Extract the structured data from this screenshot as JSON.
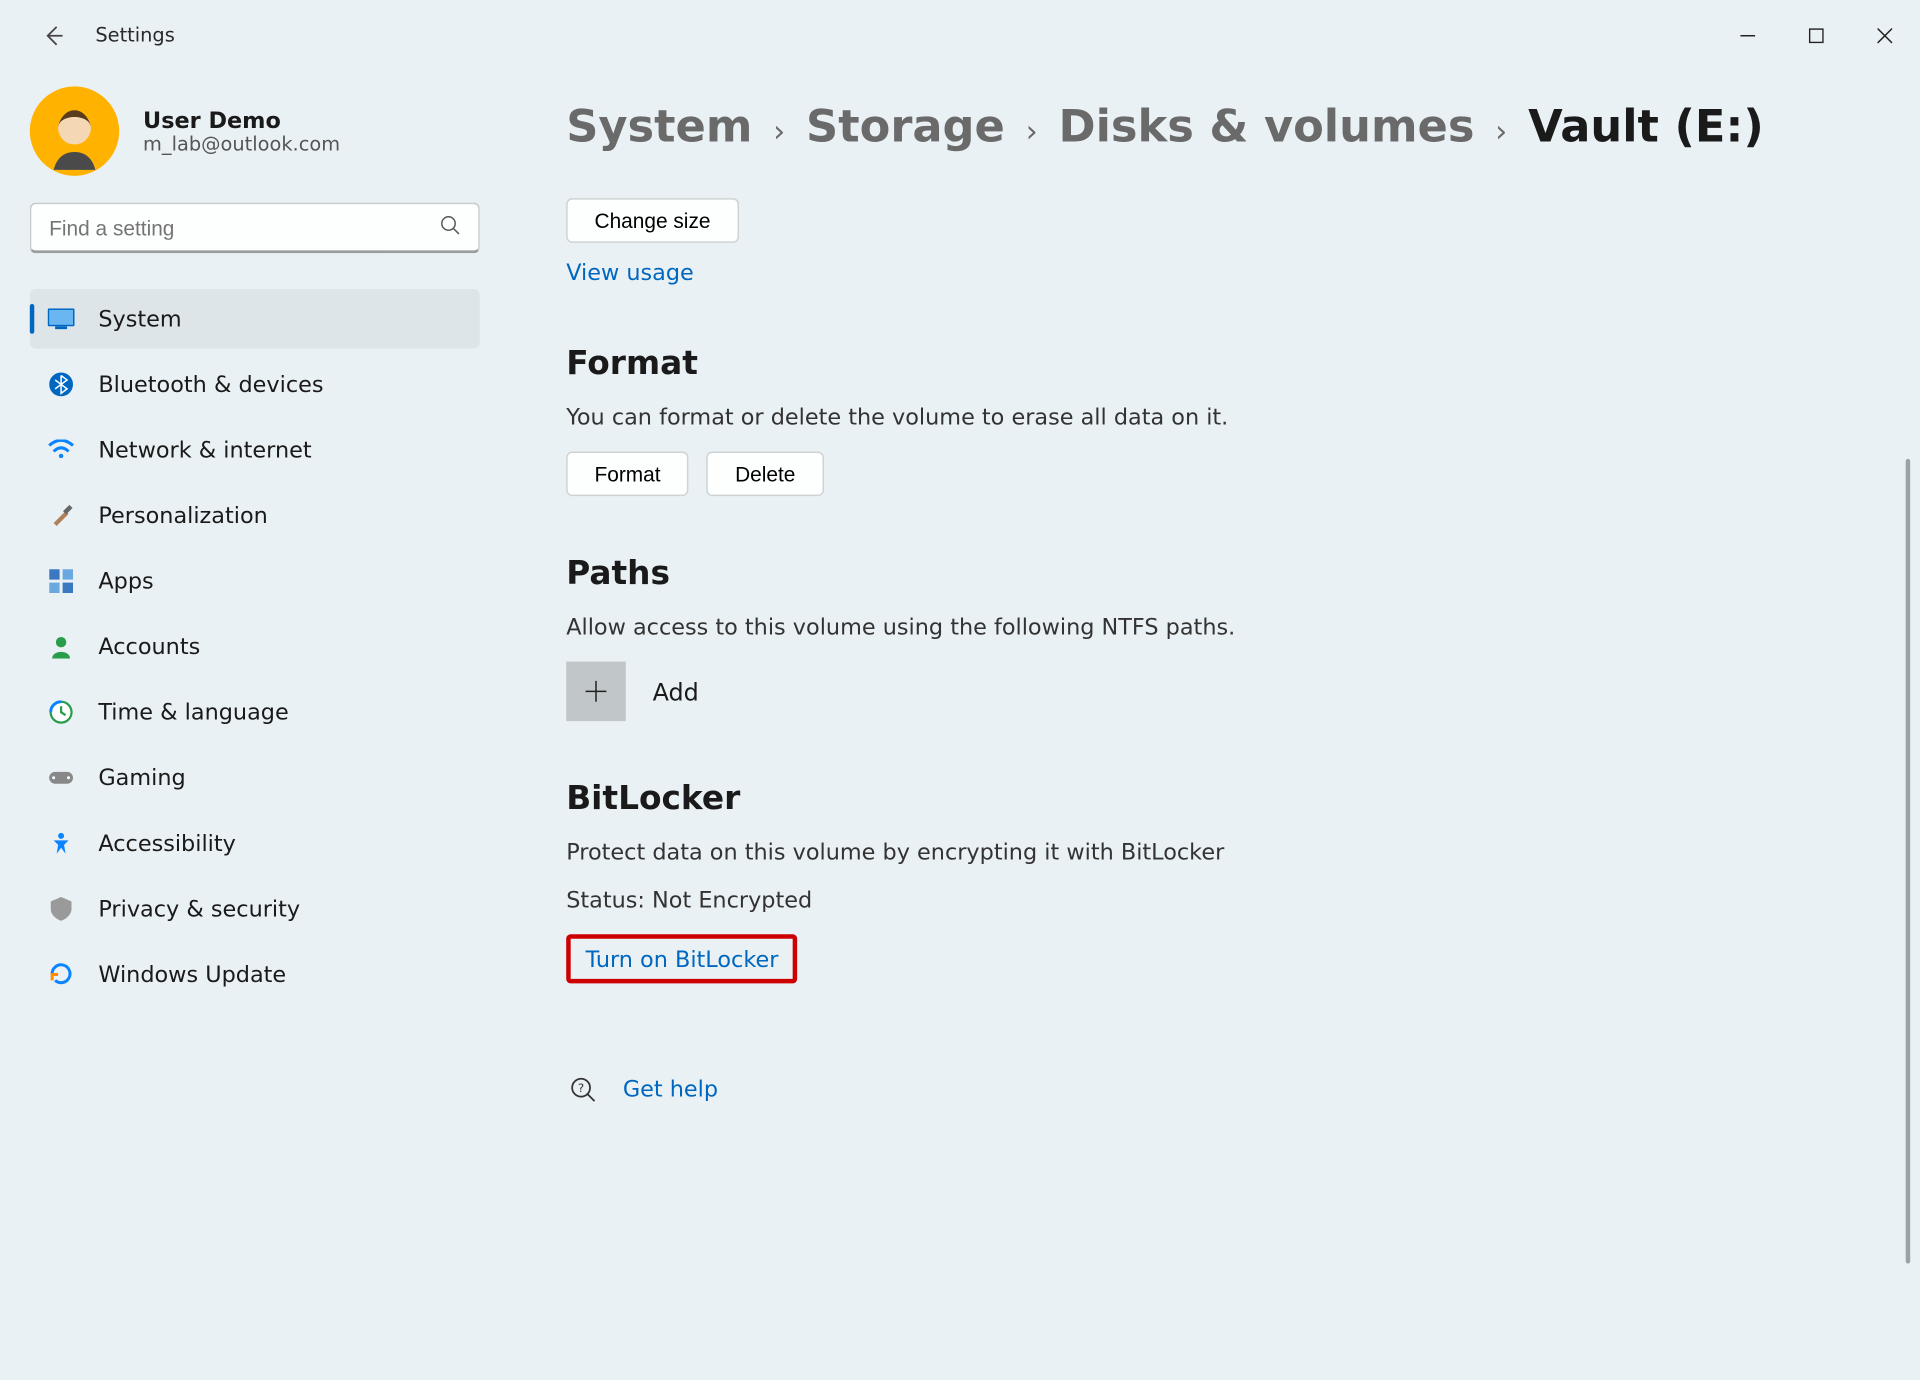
{
  "app_title": "Settings",
  "user": {
    "name": "User Demo",
    "email": "m_lab@outlook.com"
  },
  "search": {
    "placeholder": "Find a setting"
  },
  "sidebar": {
    "items": [
      {
        "label": "System",
        "icon": "system-icon",
        "color": "#0067c0"
      },
      {
        "label": "Bluetooth & devices",
        "icon": "bluetooth-icon",
        "color": "#0067c0"
      },
      {
        "label": "Network & internet",
        "icon": "wifi-icon",
        "color": "#0a84ff"
      },
      {
        "label": "Personalization",
        "icon": "brush-icon",
        "color": "#555"
      },
      {
        "label": "Apps",
        "icon": "apps-icon",
        "color": "#3a78c2"
      },
      {
        "label": "Accounts",
        "icon": "person-icon",
        "color": "#2a9d4a"
      },
      {
        "label": "Time & language",
        "icon": "clock-icon",
        "color": "#2a9d4a"
      },
      {
        "label": "Gaming",
        "icon": "gamepad-icon",
        "color": "#888"
      },
      {
        "label": "Accessibility",
        "icon": "accessibility-icon",
        "color": "#0a84ff"
      },
      {
        "label": "Privacy & security",
        "icon": "shield-icon",
        "color": "#888"
      },
      {
        "label": "Windows Update",
        "icon": "update-icon",
        "color": "#0a84ff"
      }
    ]
  },
  "breadcrumbs": [
    {
      "label": "System"
    },
    {
      "label": "Storage"
    },
    {
      "label": "Disks & volumes"
    },
    {
      "label": "Vault (E:)"
    }
  ],
  "change_size_label": "Change size",
  "view_usage_label": "View usage",
  "format": {
    "heading": "Format",
    "desc": "You can format or delete the volume to erase all data on it.",
    "format_label": "Format",
    "delete_label": "Delete"
  },
  "paths": {
    "heading": "Paths",
    "desc": "Allow access to this volume using the following NTFS paths.",
    "add_label": "Add"
  },
  "bitlocker": {
    "heading": "BitLocker",
    "desc": "Protect data on this volume by encrypting it with BitLocker",
    "status": "Status: Not Encrypted",
    "turn_on_label": "Turn on BitLocker"
  },
  "get_help_label": "Get help"
}
